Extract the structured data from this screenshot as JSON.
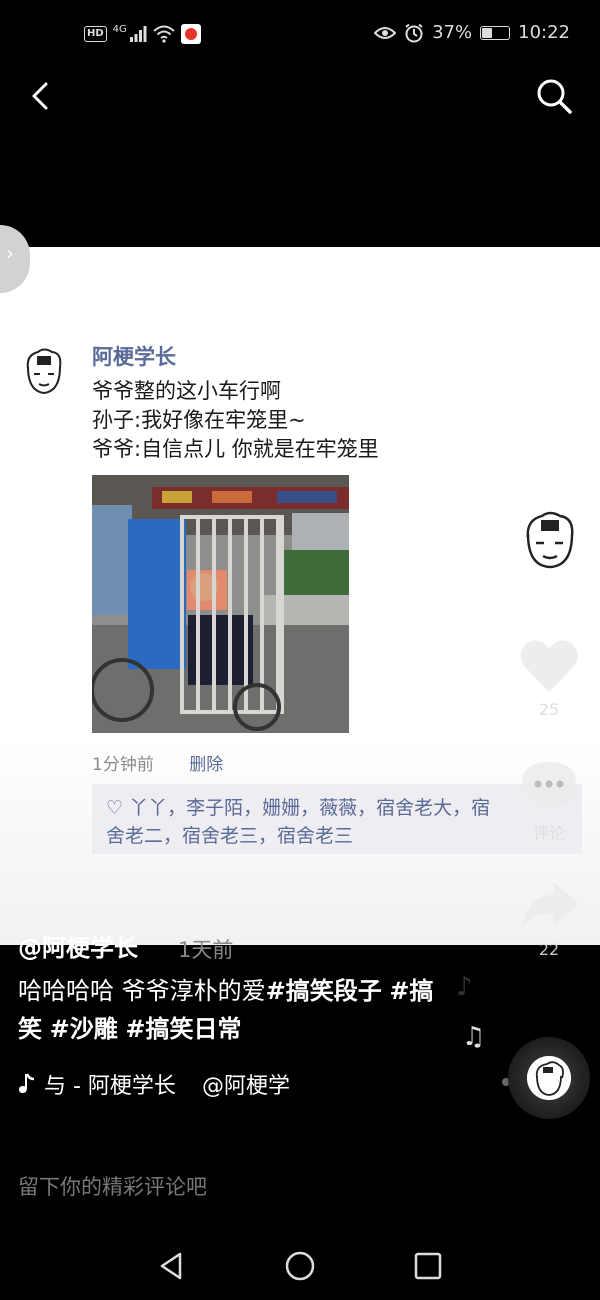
{
  "status_bar": {
    "hd": "HD",
    "network": "4G",
    "battery_percent": "37%",
    "battery_level": 0.37,
    "time": "10:22"
  },
  "top_nav": {
    "back_icon": "chevron-left-icon",
    "search_icon": "search-icon"
  },
  "post": {
    "author": "阿梗学长",
    "lines": [
      "爷爷整的这小车行啊",
      "孙子:我好像在牢笼里~",
      "爷爷:自信点儿 你就是在牢笼里"
    ],
    "time": "1分钟前",
    "delete_label": "删除",
    "likes_line1": "♡ 丫丫，李子陌，姗姗，薇薇，宿舍老大，宿",
    "likes_line2": "舍老二，宿舍老三，宿舍老三"
  },
  "rail": {
    "like_count": "25",
    "comment_label": "评论",
    "share_count": "22"
  },
  "video": {
    "author": "@阿梗学长",
    "time": "1天前",
    "caption_text": "哈哈哈哈 爷爷淳朴的爱",
    "tags": [
      "#搞笑段子",
      "#搞笑",
      "#沙雕",
      "#搞笑日常"
    ],
    "music_prefix": "与 - 阿梗学长",
    "music_suffix": "@阿梗学"
  },
  "comment": {
    "placeholder": "留下你的精彩评论吧"
  },
  "colors": {
    "link_blue": "#5b6b98",
    "background": "#000000"
  }
}
